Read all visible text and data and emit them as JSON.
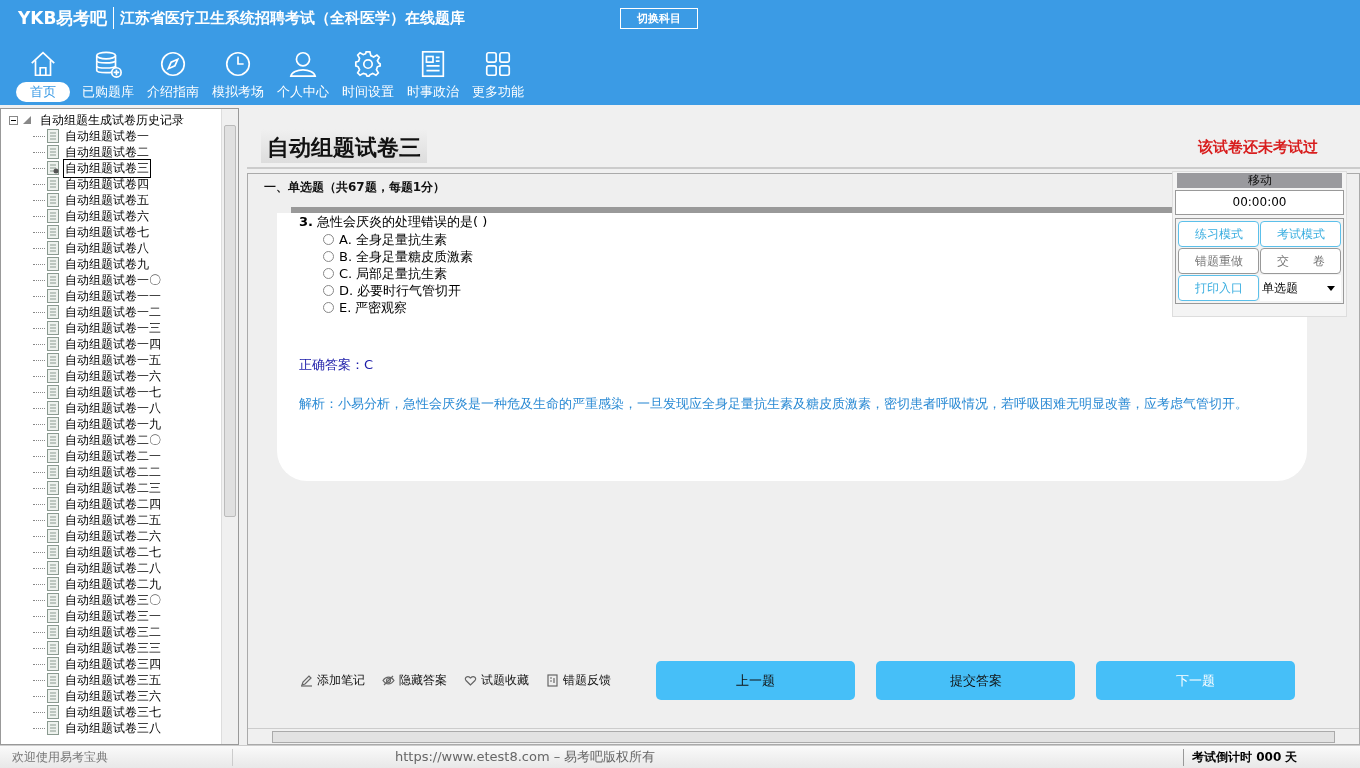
{
  "header": {
    "logo": "YKB易考吧",
    "title": "江苏省医疗卫生系统招聘考试（全科医学）在线题库",
    "switch_button": "切换科目"
  },
  "nav": [
    {
      "label": "首页",
      "selected": true
    },
    {
      "label": "已购题库",
      "selected": false
    },
    {
      "label": "介绍指南",
      "selected": false
    },
    {
      "label": "模拟考场",
      "selected": false
    },
    {
      "label": "个人中心",
      "selected": false
    },
    {
      "label": "时间设置",
      "selected": false
    },
    {
      "label": "时事政治",
      "selected": false
    },
    {
      "label": "更多功能",
      "selected": false
    }
  ],
  "tree": {
    "label": "自动组题生成试卷历史记录",
    "expanded": true,
    "children": [
      {
        "label": "自动组题试卷一",
        "selected": false
      },
      {
        "label": "自动组题试卷二",
        "selected": false
      },
      {
        "label": "自动组题试卷三",
        "selected": true
      },
      {
        "label": "自动组题试卷四",
        "selected": false
      },
      {
        "label": "自动组题试卷五",
        "selected": false
      },
      {
        "label": "自动组题试卷六",
        "selected": false
      },
      {
        "label": "自动组题试卷七",
        "selected": false
      },
      {
        "label": "自动组题试卷八",
        "selected": false
      },
      {
        "label": "自动组题试卷九",
        "selected": false
      },
      {
        "label": "自动组题试卷一〇",
        "selected": false
      },
      {
        "label": "自动组题试卷一一",
        "selected": false
      },
      {
        "label": "自动组题试卷一二",
        "selected": false
      },
      {
        "label": "自动组题试卷一三",
        "selected": false
      },
      {
        "label": "自动组题试卷一四",
        "selected": false
      },
      {
        "label": "自动组题试卷一五",
        "selected": false
      },
      {
        "label": "自动组题试卷一六",
        "selected": false
      },
      {
        "label": "自动组题试卷一七",
        "selected": false
      },
      {
        "label": "自动组题试卷一八",
        "selected": false
      },
      {
        "label": "自动组题试卷一九",
        "selected": false
      },
      {
        "label": "自动组题试卷二〇",
        "selected": false
      },
      {
        "label": "自动组题试卷二一",
        "selected": false
      },
      {
        "label": "自动组题试卷二二",
        "selected": false
      },
      {
        "label": "自动组题试卷二三",
        "selected": false
      },
      {
        "label": "自动组题试卷二四",
        "selected": false
      },
      {
        "label": "自动组题试卷二五",
        "selected": false
      },
      {
        "label": "自动组题试卷二六",
        "selected": false
      },
      {
        "label": "自动组题试卷二七",
        "selected": false
      },
      {
        "label": "自动组题试卷二八",
        "selected": false
      },
      {
        "label": "自动组题试卷二九",
        "selected": false
      },
      {
        "label": "自动组题试卷三〇",
        "selected": false
      },
      {
        "label": "自动组题试卷三一",
        "selected": false
      },
      {
        "label": "自动组题试卷三二",
        "selected": false
      },
      {
        "label": "自动组题试卷三三",
        "selected": false
      },
      {
        "label": "自动组题试卷三四",
        "selected": false
      },
      {
        "label": "自动组题试卷三五",
        "selected": false
      },
      {
        "label": "自动组题试卷三六",
        "selected": false
      },
      {
        "label": "自动组题试卷三七",
        "selected": false
      },
      {
        "label": "自动组题试卷三八",
        "selected": false
      }
    ]
  },
  "paper": {
    "title": "自动组题试卷三",
    "status": "该试卷还未考试过"
  },
  "section": "一、单选题（共67题，每题1分）",
  "question": {
    "number": "3.",
    "text": "急性会厌炎的处理错误的是( )",
    "options": [
      {
        "label": "A. 全身足量抗生素",
        "selected": false
      },
      {
        "label": "B. 全身足量糖皮质激素",
        "selected": false
      },
      {
        "label": "C. 局部足量抗生素",
        "selected": false
      },
      {
        "label": "D. 必要时行气管切开",
        "selected": false
      },
      {
        "label": "E. 严密观察",
        "selected": false
      }
    ],
    "answer": "正确答案：C",
    "analysis": "解析：小易分析，急性会厌炎是一种危及生命的严重感染，一旦发现应全身足量抗生素及糖皮质激素，密切患者呼吸情况，若呼吸困难无明显改善，应考虑气管切开。"
  },
  "panel": {
    "header": "移动",
    "timer": "00:00:00",
    "buttons": [
      {
        "label": "练习模式",
        "disabled": false
      },
      {
        "label": "考试模式",
        "disabled": false
      },
      {
        "label": "错题重做",
        "disabled": true
      },
      {
        "label": "交　　卷",
        "disabled": true
      },
      {
        "label": "打印入口",
        "disabled": false
      }
    ],
    "type_select": "单选题"
  },
  "tools": [
    "添加笔记",
    "隐藏答案",
    "试题收藏",
    "错题反馈"
  ],
  "actions": [
    {
      "label": "上一题",
      "disabled": false
    },
    {
      "label": "提交答案",
      "disabled": false
    },
    {
      "label": "下一题",
      "disabled": true
    }
  ],
  "status_bar": {
    "welcome": "欢迎使用易考宝典",
    "copyright": "https://www.etest8.com – 易考吧版权所有",
    "countdown": "考试倒计时 000 天"
  }
}
